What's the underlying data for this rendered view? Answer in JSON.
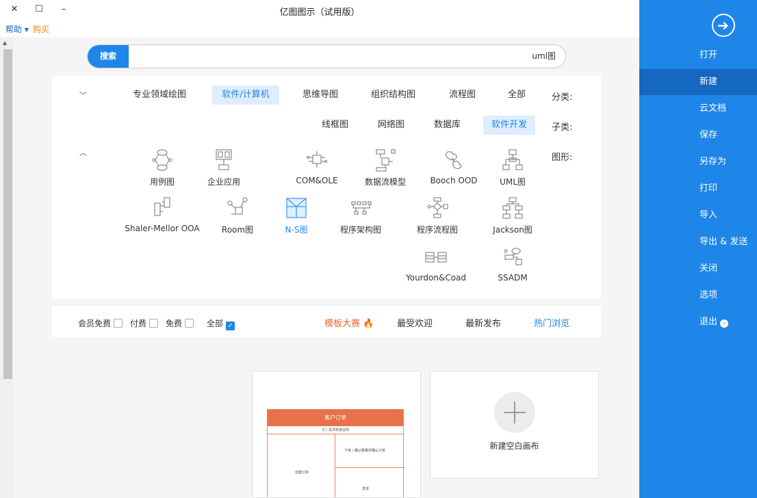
{
  "window": {
    "title": "亿图图示（试用版）",
    "minimize_glyph": "–",
    "maximize_glyph": "☐",
    "close_glyph": "✕"
  },
  "menubar": {
    "help": "帮助 ▾",
    "buy": "购买"
  },
  "sidebar": {
    "back_icon": "arrow-right-circle-icon",
    "items": [
      {
        "label": "打开"
      },
      {
        "label": "新建",
        "active": true
      },
      {
        "label": "云文档"
      },
      {
        "label": "保存"
      },
      {
        "label": "另存为"
      },
      {
        "label": "打印"
      },
      {
        "label": "导入"
      },
      {
        "label": "导出 & 发送"
      },
      {
        "label": "关闭"
      },
      {
        "label": "选项"
      },
      {
        "label": "退出",
        "icon": "minus-circle-icon"
      }
    ]
  },
  "search": {
    "button": "搜索",
    "value": "uml图"
  },
  "categories": {
    "label": "分类:",
    "items": [
      "全部",
      "流程图",
      "组织结构图",
      "思维导图",
      "软件/计算机",
      "专业领域绘图"
    ],
    "selected": "软件/计算机"
  },
  "subcategories": {
    "label": "子类:",
    "items": [
      "软件开发",
      "数据库",
      "网络图",
      "线框图"
    ],
    "selected": "软件开发"
  },
  "shapes": {
    "label": "图形:",
    "items": [
      {
        "label": "UML图",
        "icon": "uml-diagram-icon"
      },
      {
        "label": "Booch OOD",
        "icon": "booch-ood-icon"
      },
      {
        "label": "数据流模型",
        "icon": "data-flow-model-icon"
      },
      {
        "label": "COM&OLE",
        "icon": "com-ole-icon"
      },
      {
        "label": "企业应用",
        "icon": "enterprise-application-icon"
      },
      {
        "label": "用例图",
        "icon": "use-case-diagram-icon"
      },
      {
        "label": "Jackson图",
        "icon": "jackson-diagram-icon"
      },
      {
        "label": "程序流程图",
        "icon": "program-flowchart-icon"
      },
      {
        "label": "程序架构图",
        "icon": "program-architecture-icon"
      },
      {
        "label": "N-S图",
        "icon": "ns-diagram-icon",
        "selected": true
      },
      {
        "label": "Room图",
        "icon": "room-diagram-icon"
      },
      {
        "label": "Shaler-Mellor OOA",
        "icon": "shlaer-mellor-ooa-icon"
      },
      {
        "label": "SSADM",
        "icon": "ssadm-icon"
      },
      {
        "label": "Yourdon&Coad",
        "icon": "yourdon-coad-icon"
      }
    ]
  },
  "filter": {
    "tabs": [
      "热门浏览",
      "最新发布",
      "最受欢迎",
      "模板大赛"
    ],
    "active_tab": "热门浏览",
    "contest_icon": "flame-icon",
    "checks": [
      {
        "label": "全部",
        "checked": true
      },
      {
        "label": "免费",
        "checked": false
      },
      {
        "label": "付费",
        "checked": false
      },
      {
        "label": "会员免费",
        "checked": false
      }
    ]
  },
  "cards": {
    "new_blank": "新建空白画布",
    "template": {
      "title": "客户订单",
      "subtitle": "文 | 需求数量说明",
      "left_text": "创建订单",
      "right_text": "下单 / 确认数量并确认订单",
      "bottom_text": "发货"
    }
  },
  "colors": {
    "accent": "#1e86e8",
    "sidebar_bg": "#1e86e8",
    "sidebar_active": "#1567c0",
    "buy": "#f08a00",
    "contest": "#f0642a",
    "template_head": "#e8704a"
  }
}
